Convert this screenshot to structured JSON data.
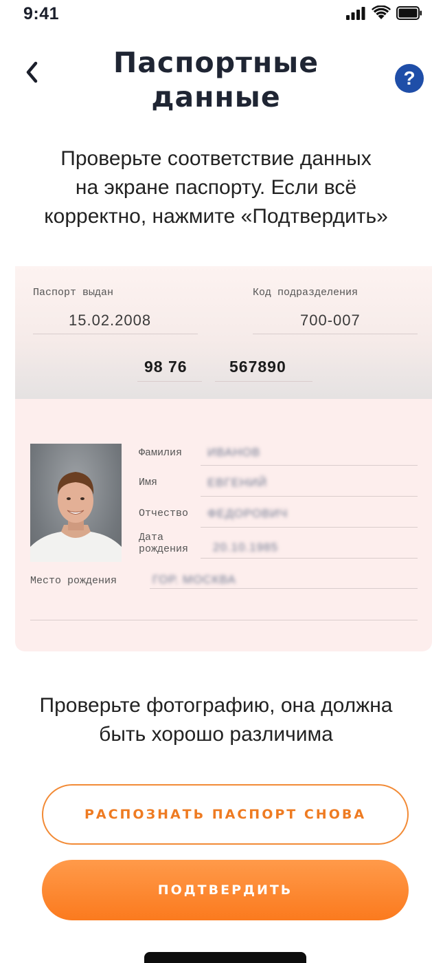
{
  "status_bar": {
    "time": "9:41"
  },
  "header": {
    "title_line1": "Паспортные",
    "title_line2": "данные",
    "help_label": "?"
  },
  "instruction": {
    "line1": "Проверьте соответствие данных",
    "line2": "на экране паспорту. Если всё",
    "line3": "корректно, нажмите «Подтвердить»"
  },
  "passport": {
    "issued_label": "Паспорт выдан",
    "issued_value": "15.02.2008",
    "division_label": "Код подразделения",
    "division_value": "700-007",
    "series": "98 76",
    "number": "567890",
    "surname_label": "Фамилия",
    "surname_value": "ИВАНОВ",
    "name_label": "Имя",
    "name_value": "ЕВГЕНИЙ",
    "patronymic_label": "Отчество",
    "patronymic_value": "ФЕДОРОВИЧ",
    "birthdate_label_line1": "Дата",
    "birthdate_label_line2": "рождения",
    "birthdate_value": "20.10.1985",
    "birthplace_label": "Место рождения",
    "birthplace_value": "ГОР. МОСКВА"
  },
  "photo_hint": {
    "line1": "Проверьте фотографию, она должна",
    "line2": "быть хорошо различима"
  },
  "buttons": {
    "rescan_label": "РАСПОЗНАТЬ ПАСПОРТ СНОВА",
    "confirm_label": "ПОДТВЕРДИТЬ"
  },
  "colors": {
    "accent": "#fb7a1e",
    "help": "#1f4ea8",
    "passport_bg": "#fdeeed"
  },
  "icons": {
    "back": "chevron-left-icon",
    "signal": "signal-bars-icon",
    "wifi": "wifi-icon",
    "battery": "battery-icon"
  }
}
